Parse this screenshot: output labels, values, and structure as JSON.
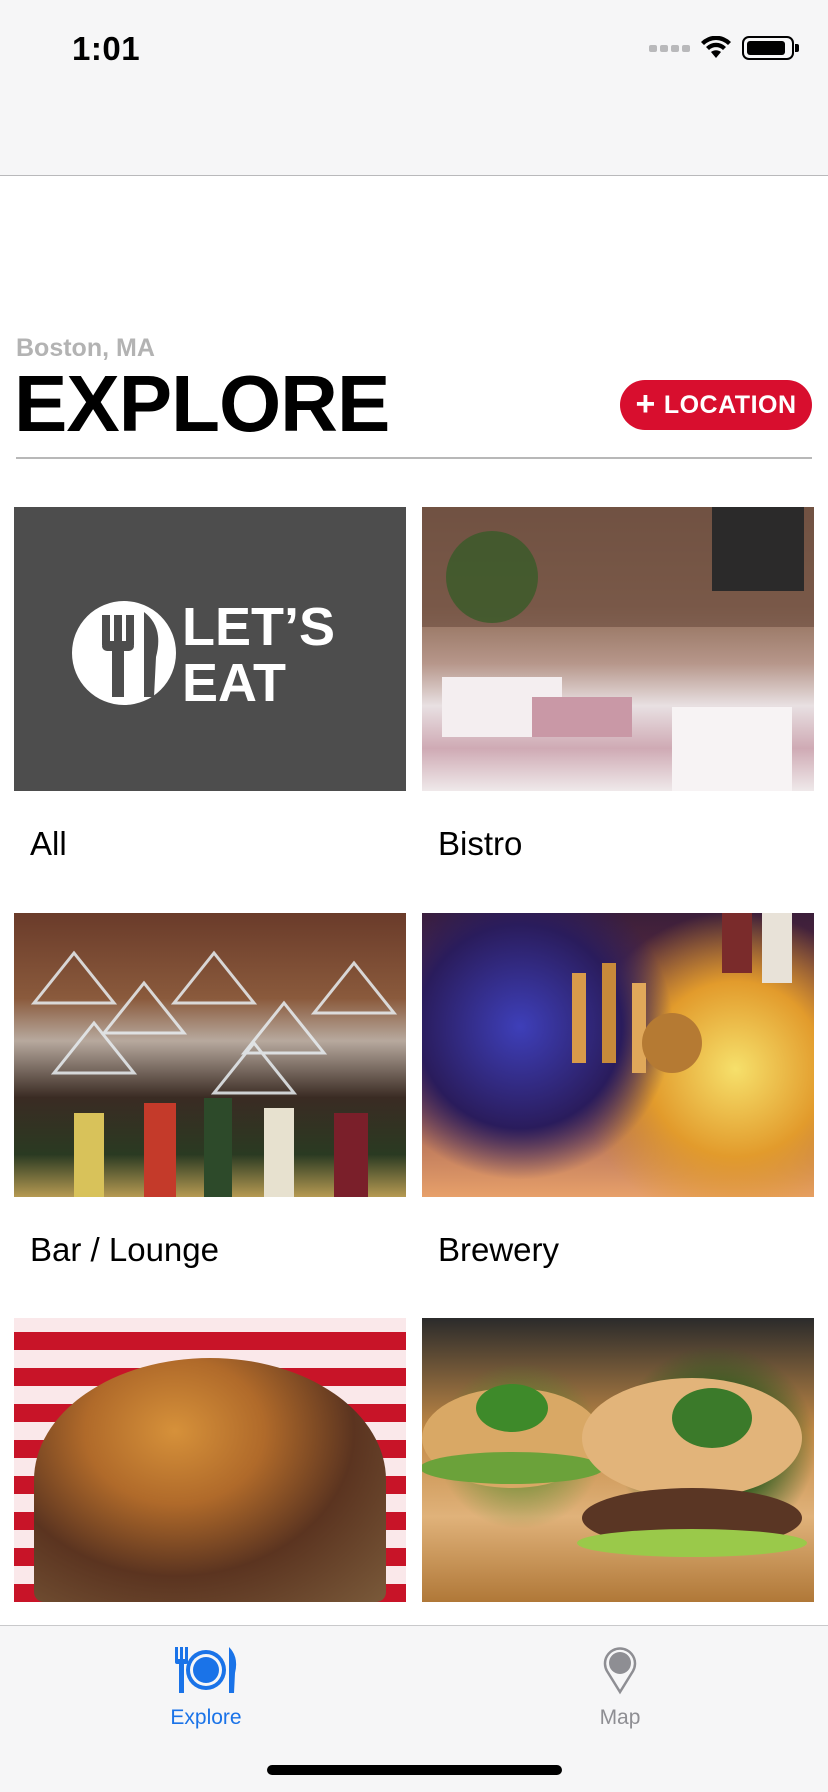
{
  "status_bar": {
    "time": "1:01",
    "icons": [
      "signal-icon",
      "wifi-icon",
      "battery-icon"
    ],
    "battery_level": 0.9
  },
  "header": {
    "location": "Boston, MA",
    "title": "EXPLORE",
    "add_location_label": "LOCATION",
    "add_location_icon": "plus-icon",
    "accent_color": "#d80e2e"
  },
  "categories": [
    {
      "label": "All",
      "image": "lets-eat-logo",
      "logo_text_1": "LET’S",
      "logo_text_2": "EAT"
    },
    {
      "label": "Bistro",
      "image": "bistro-photo"
    },
    {
      "label": "Bar / Lounge",
      "image": "bar-lounge-photo"
    },
    {
      "label": "Brewery",
      "image": "brewery-photo"
    },
    {
      "label": "",
      "image": "burger-photo"
    },
    {
      "label": "",
      "image": "burger-photo-2"
    }
  ],
  "tabbar": {
    "tabs": [
      {
        "label": "Explore",
        "icon": "fork-plate-knife-icon",
        "selected": true
      },
      {
        "label": "Map",
        "icon": "map-pin-icon",
        "selected": false
      }
    ],
    "selected_color": "#1a73e8",
    "unselected_color": "#8e8e93"
  }
}
